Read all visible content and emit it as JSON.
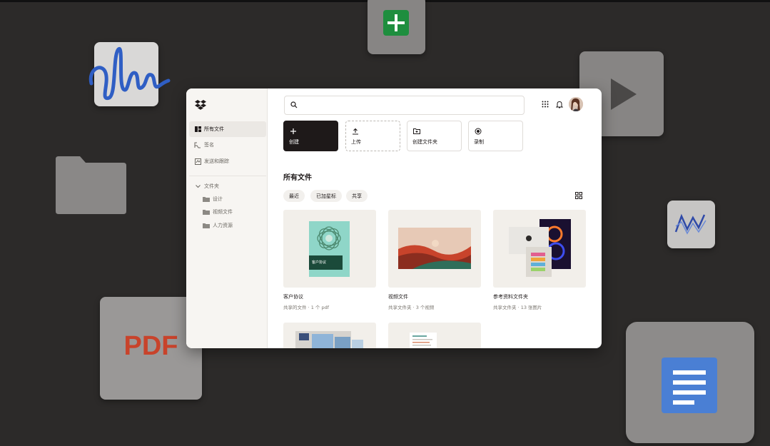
{
  "background_tiles": {
    "pdf_label": "PDF"
  },
  "app": {
    "sidebar": {
      "nav": [
        {
          "label": "所有文件",
          "icon": "files-icon",
          "active": true
        },
        {
          "label": "签名",
          "icon": "signature-icon",
          "active": false
        },
        {
          "label": "发送和跟踪",
          "icon": "send-track-icon",
          "active": false
        }
      ],
      "folders_header": "文件夹",
      "folders": [
        "设计",
        "视频文件",
        "人力资源"
      ]
    },
    "search": {
      "placeholder": ""
    },
    "actions": [
      {
        "label": "创建",
        "icon": "plus-icon"
      },
      {
        "label": "上传",
        "icon": "upload-icon"
      },
      {
        "label": "创建文件夹",
        "icon": "new-folder-icon"
      },
      {
        "label": "录制",
        "icon": "record-icon"
      }
    ],
    "section_title": "所有文件",
    "filters": [
      "最近",
      "已加星标",
      "共享"
    ],
    "cards": [
      {
        "name": "客户协议",
        "meta": "共享的文件 · 1 个 pdf",
        "thumb_label": "客户协议"
      },
      {
        "name": "视频文件",
        "meta": "共享文件夹 · 3 个视频"
      },
      {
        "name": "参考资料文件夹",
        "meta": "共享文件夹 · 13 张图片"
      },
      {
        "name": "",
        "meta": ""
      },
      {
        "name": "",
        "meta": ""
      }
    ]
  },
  "colors": {
    "accent_dark": "#1e1919",
    "sidebar_bg": "#f7f5f2",
    "sheets_green": "#1e8e3e",
    "docs_blue": "#4a7fd4",
    "pdf_red": "#c8432b"
  }
}
